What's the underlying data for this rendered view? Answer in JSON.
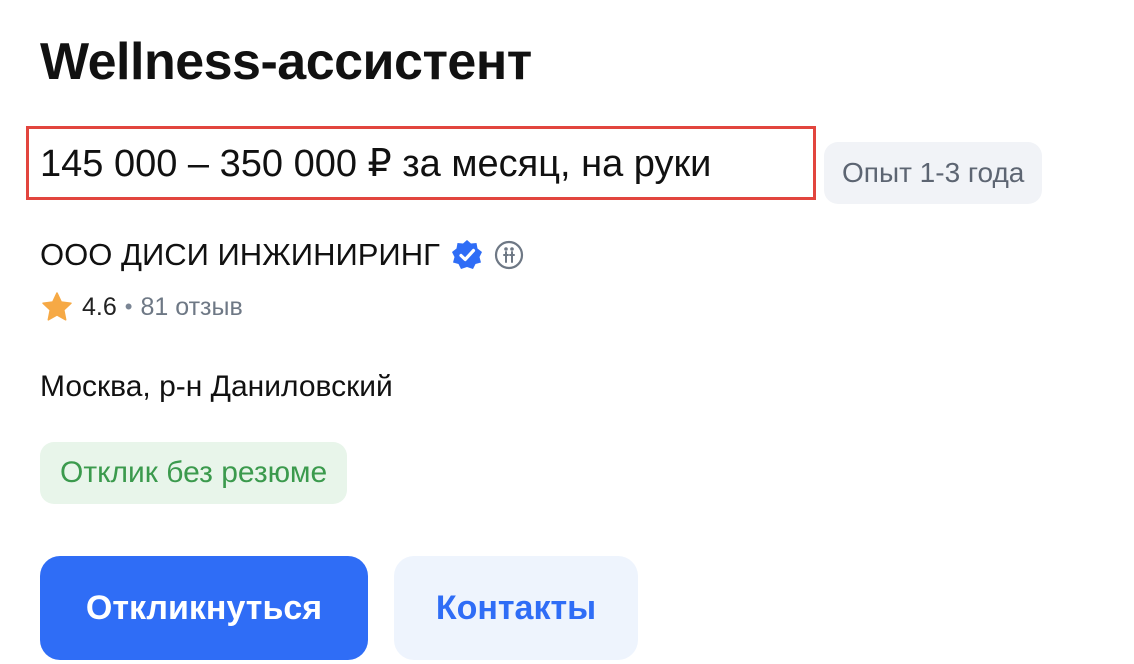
{
  "vacancy": {
    "title": "Wellness-ассистент",
    "salary": "145 000 – 350 000 ₽ за месяц, на руки",
    "experience": "Опыт 1-3 года"
  },
  "company": {
    "name": "ООО ДИСИ ИНЖИНИРИНГ",
    "rating": "4.6",
    "separator": "•",
    "reviews": "81 отзыв"
  },
  "location": "Москва, р-н Даниловский",
  "badges": {
    "no_resume": "Отклик без резюме"
  },
  "actions": {
    "respond_label": "Откликнуться",
    "contacts_label": "Контакты"
  },
  "colors": {
    "accent": "#2f6df6",
    "highlight_border": "#e2453e",
    "star": "#f6a945",
    "success_text": "#3b9a4d",
    "success_bg": "#e8f5ea"
  },
  "icons": {
    "verified": "verified-badge-icon",
    "accessible": "accessible-employer-icon",
    "rating": "star-icon"
  }
}
